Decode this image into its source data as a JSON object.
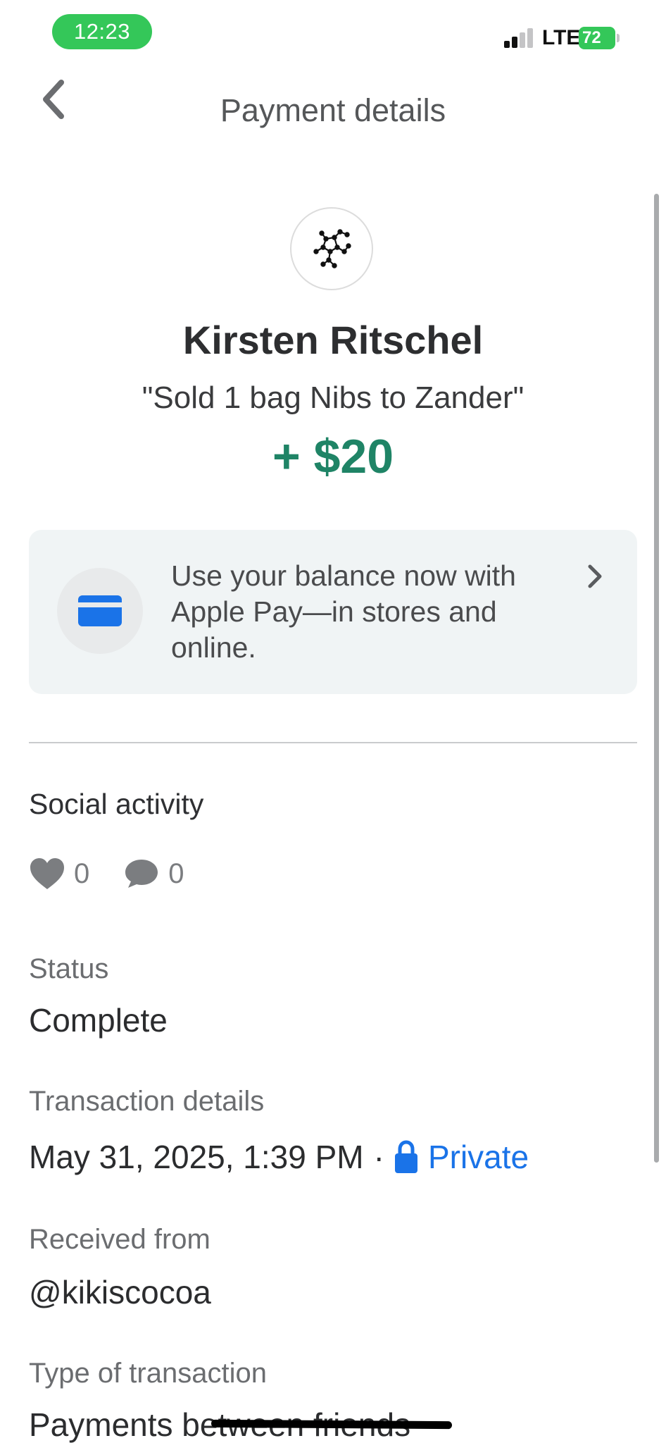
{
  "status_bar": {
    "time": "12:23",
    "network": "LTE",
    "battery": "72"
  },
  "header": {
    "title": "Payment details"
  },
  "profile": {
    "name": "Kirsten Ritschel",
    "note": "\"Sold 1 bag Nibs to Zander\"",
    "amount": "+ $20"
  },
  "promo": {
    "text": "Use your balance now with Apple Pay—in stores and online.",
    "icon": "credit-card-icon"
  },
  "social": {
    "title": "Social activity",
    "likes": "0",
    "comments": "0"
  },
  "details": {
    "status_label": "Status",
    "status_value": "Complete",
    "transaction_label": "Transaction details",
    "transaction_date": "May 31, 2025, 1:39 PM",
    "separator": "·",
    "privacy": "Private",
    "received_label": "Received from",
    "received_value": "@kikiscocoa",
    "type_label": "Type of transaction",
    "type_value": "Payments between friends"
  },
  "colors": {
    "accent_blue": "#1a73e8",
    "amount_green": "#1f8466",
    "status_green": "#34c759"
  }
}
